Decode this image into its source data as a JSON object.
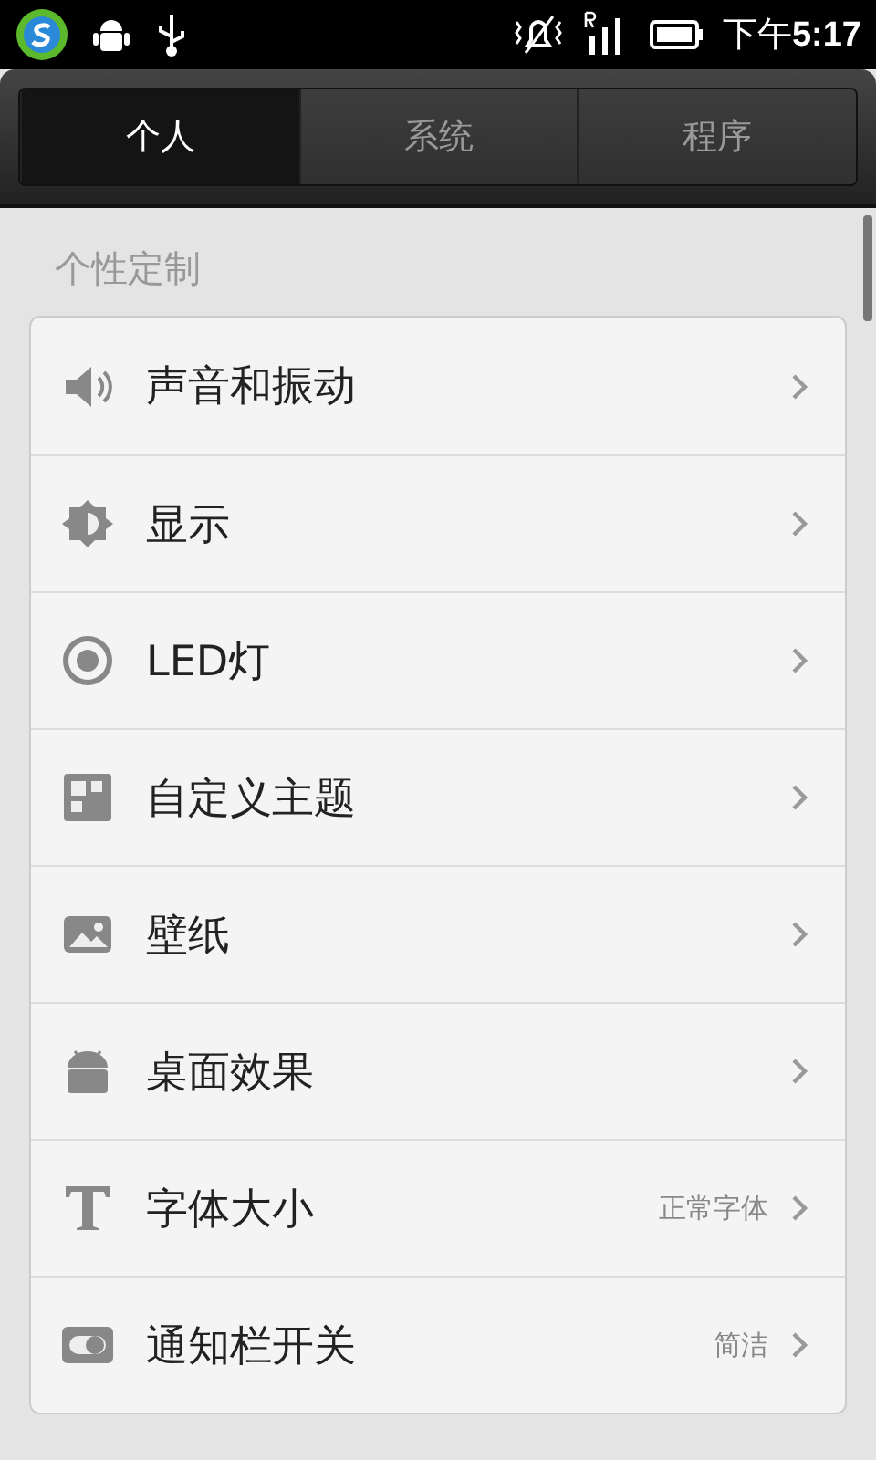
{
  "status_bar": {
    "time_prefix": "下午",
    "time": "5:17"
  },
  "tabs": [
    {
      "label": "个人",
      "selected": true
    },
    {
      "label": "系统",
      "selected": false
    },
    {
      "label": "程序",
      "selected": false
    }
  ],
  "sections": [
    {
      "title": "个性定制",
      "items": [
        {
          "kind": "speaker",
          "label": "声音和振动"
        },
        {
          "kind": "brightness",
          "label": "显示"
        },
        {
          "kind": "led",
          "label": "LED灯"
        },
        {
          "kind": "theme",
          "label": "自定义主题"
        },
        {
          "kind": "wallpaper",
          "label": "壁纸"
        },
        {
          "kind": "android",
          "label": "桌面效果"
        },
        {
          "kind": "font",
          "label": "字体大小",
          "value": "正常字体"
        },
        {
          "kind": "toggle",
          "label": "通知栏开关",
          "value": "简洁"
        }
      ]
    }
  ]
}
